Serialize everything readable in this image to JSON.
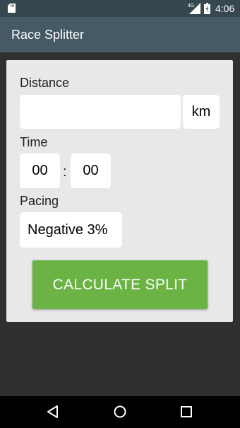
{
  "status_bar": {
    "network": "4G",
    "time": "4:06",
    "icons": [
      "sd-card-icon",
      "signal-icon",
      "battery-icon"
    ]
  },
  "app_bar": {
    "title": "Race Splitter"
  },
  "form": {
    "distance": {
      "label": "Distance",
      "value": "",
      "unit": "km"
    },
    "time": {
      "label": "Time",
      "hours": "00",
      "separator": ":",
      "minutes": "00"
    },
    "pacing": {
      "label": "Pacing",
      "selected": "Negative 3%"
    },
    "calculate_button": "CALCULATE SPLIT"
  },
  "nav_bar": {
    "icons": [
      "back-icon",
      "home-icon",
      "recents-icon"
    ]
  },
  "colors": {
    "status_bar": "#37474f",
    "app_bar": "#455a64",
    "background": "#303030",
    "card": "#e8e8e8",
    "button": "#6ab344",
    "nav_bar": "#000000"
  }
}
